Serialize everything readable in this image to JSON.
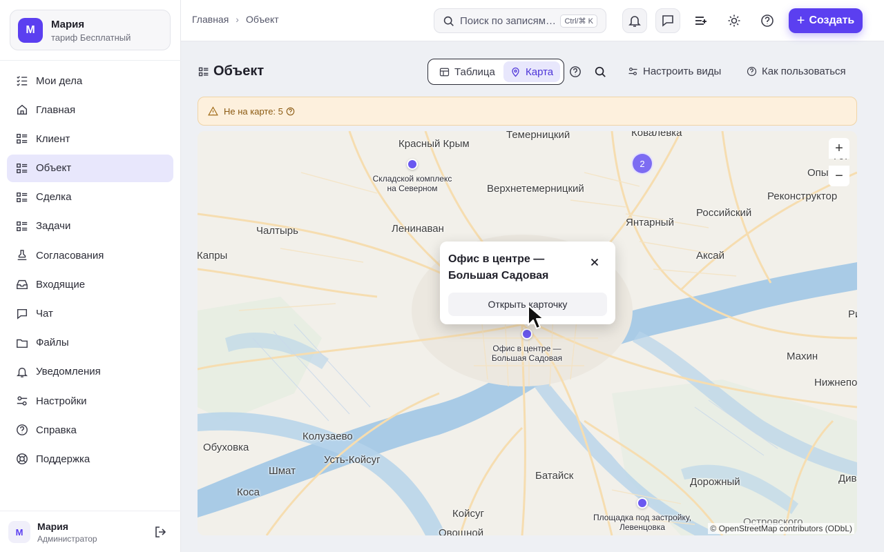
{
  "account": {
    "initial": "М",
    "name": "Мария",
    "plan": "тариф Бесплатный"
  },
  "nav": {
    "items": [
      {
        "label": "Мои дела",
        "icon": "checklist-icon"
      },
      {
        "label": "Главная",
        "icon": "home-icon"
      },
      {
        "label": "Клиент",
        "icon": "list-icon"
      },
      {
        "label": "Объект",
        "icon": "list-icon",
        "active": true
      },
      {
        "label": "Сделка",
        "icon": "list-icon"
      },
      {
        "label": "Задачи",
        "icon": "list-icon"
      },
      {
        "label": "Согласования",
        "icon": "stamp-icon"
      },
      {
        "label": "Входящие",
        "icon": "inbox-icon"
      },
      {
        "label": "Чат",
        "icon": "chat-icon"
      },
      {
        "label": "Файлы",
        "icon": "folder-icon"
      },
      {
        "label": "Уведомления",
        "icon": "bell-icon"
      },
      {
        "label": "Настройки",
        "icon": "sliders-icon"
      },
      {
        "label": "Справка",
        "icon": "help-icon"
      },
      {
        "label": "Поддержка",
        "icon": "lifebuoy-icon"
      }
    ]
  },
  "user": {
    "initial": "М",
    "name": "Мария",
    "role": "Администратор"
  },
  "breadcrumb": {
    "home": "Главная",
    "current": "Объект"
  },
  "search": {
    "placeholder": "Поиск по записям",
    "shortcut": "Ctrl/⌘ K"
  },
  "toolbar": {
    "create_label": "Создать"
  },
  "page": {
    "title": "Объект",
    "views": {
      "table": "Таблица",
      "map": "Карта"
    },
    "configure_views": "Настроить виды",
    "how_to_use": "Как пользоваться"
  },
  "warning": {
    "text": "Не на карте: 5"
  },
  "map": {
    "places": [
      "Красный Крым",
      "Темерницкий",
      "Ковалевка",
      "Верхнетемерницкий",
      "Ленинаван",
      "Чалтырь",
      "Капры",
      "Янтарный",
      "Российский",
      "Реконструктор",
      "Аксай",
      "Опытн",
      "Ал",
      "Махин",
      "Нижнепо",
      "Ри",
      "Колузаево",
      "Обуховка",
      "Усть-Койсуг",
      "Шмат",
      "Коса",
      "Батайск",
      "Дорожный",
      "Койсуг",
      "Овощной",
      "Островского",
      "Див"
    ],
    "markers": {
      "warehouse": "Складской комплекс на Северном",
      "office": "Офис в центре — Большая Садовая",
      "site": "Площадка под застройку, Левенцовка"
    },
    "cluster_count": "2",
    "zoom_in": "+",
    "zoom_out": "−",
    "attribution": "© OpenStreetMap contributors (ODbL)"
  },
  "popup": {
    "title": "Офис в центре — Большая Садовая",
    "open_label": "Открыть карточку"
  }
}
